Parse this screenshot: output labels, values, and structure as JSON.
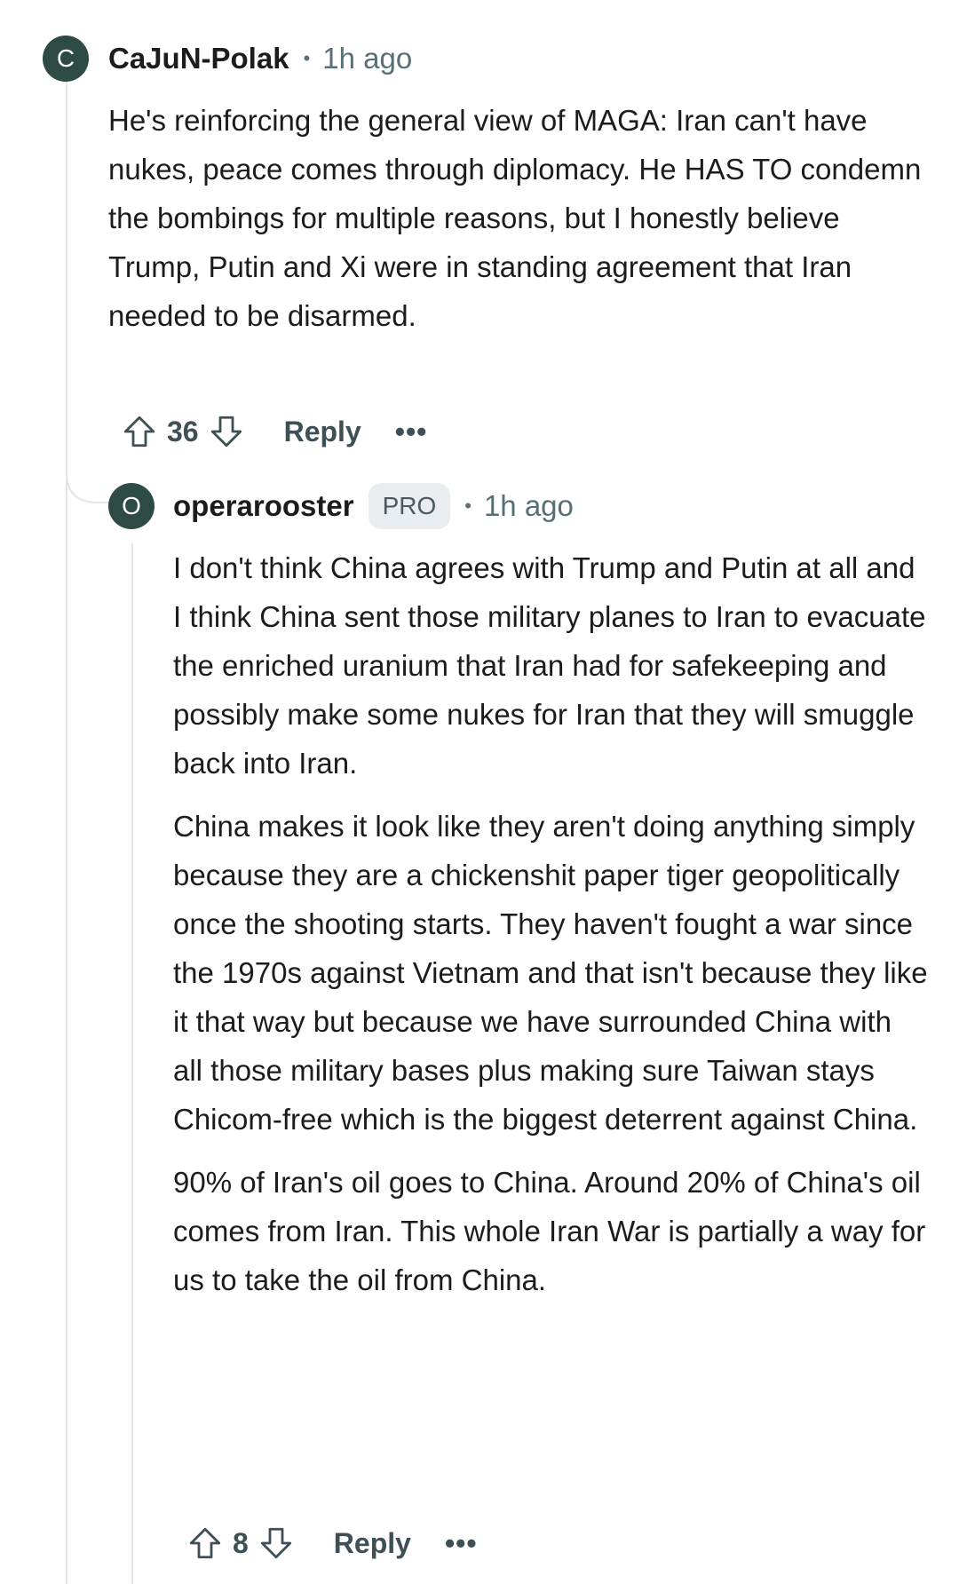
{
  "comments": [
    {
      "avatar_letter": "C",
      "username": "CaJuN-Polak",
      "separator": "•",
      "time": "1h ago",
      "body": [
        "He's reinforcing the general view of MAGA: Iran can't have nukes, peace comes through diplomacy. He HAS TO condemn the bombings for multiple reasons, but I honestly believe Trump, Putin and Xi were in standing agreement that Iran needed to be disarmed."
      ],
      "score": "36",
      "reply_label": "Reply",
      "more_label": "•••"
    },
    {
      "avatar_letter": "O",
      "username": "operarooster",
      "badge": "PRO",
      "separator": "•",
      "time": "1h ago",
      "body": [
        "I don't think China agrees with Trump and Putin at all and I think China sent those military planes to Iran to evacuate the enriched uranium that Iran had for safekeeping and possibly make some nukes for Iran that they will smuggle back into Iran.",
        "China makes it look like they aren't doing anything simply because they are a chickenshit paper tiger geopolitically once the shooting starts. They haven't fought a war since the 1970s against Vietnam and that isn't because they like it that way but because we have surrounded China with all those military bases plus making sure Taiwan stays Chicom-free which is the biggest deterrent against China.",
        "90% of Iran's oil goes to China. Around 20% of China's oil comes from Iran. This whole Iran War is partially a way for us to take the oil from China."
      ],
      "score": "8",
      "reply_label": "Reply",
      "more_label": "•••"
    }
  ],
  "icons": {
    "upvote": "arrow-up-outline",
    "downvote": "arrow-down-outline",
    "more": "ellipsis"
  },
  "colors": {
    "avatar_bg": "#2d4a45",
    "thread_line": "#e3e6e8",
    "meta_text": "#576f76",
    "badge_bg": "#eaedef"
  }
}
